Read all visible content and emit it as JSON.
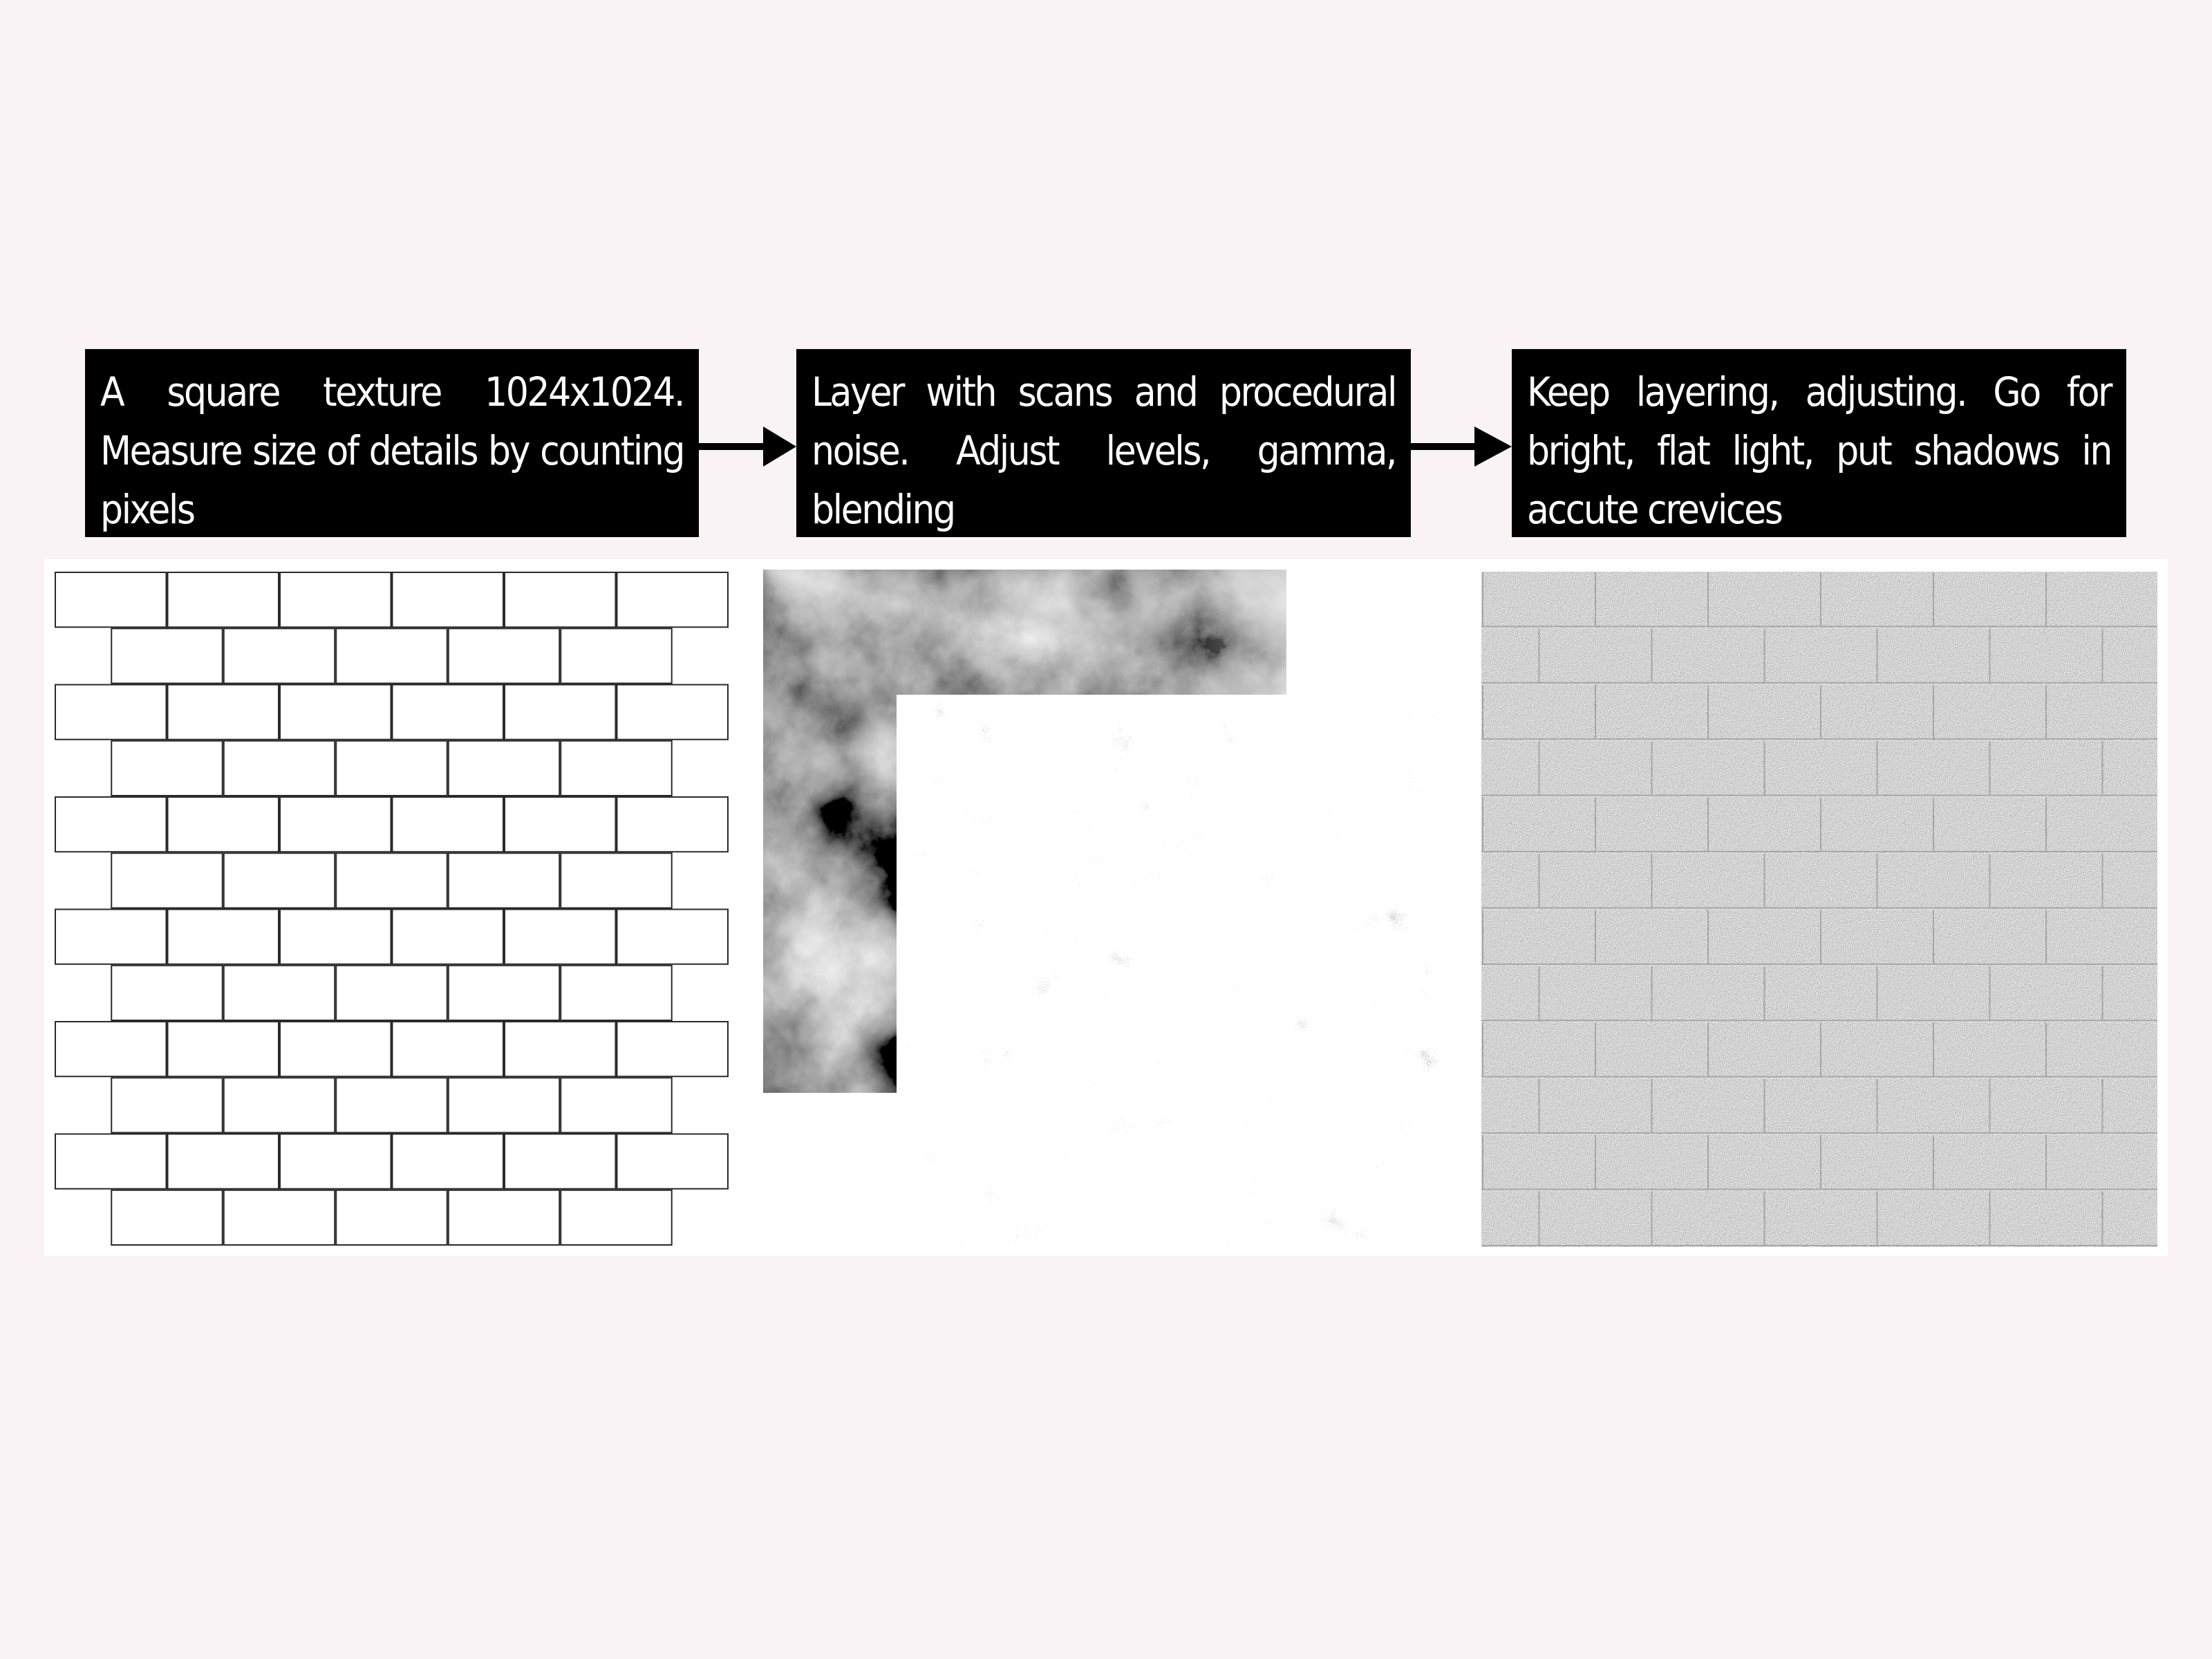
{
  "colors": {
    "page_background": "#f9f3f5",
    "box_background": "#000000",
    "box_text": "#ffffff",
    "panel_background": "#ffffff",
    "brick_line": "#2a2a2a",
    "final_brick_fill": "#ececec",
    "final_brick_groove": "#9a9a9a"
  },
  "steps": [
    {
      "id": "step-1",
      "text": "A square texture 1024x1024. Measure size of details by counting pixels"
    },
    {
      "id": "step-2",
      "text": "Layer with scans and procedural noise. Adjust levels, gamma, blending"
    },
    {
      "id": "step-3",
      "text": "Keep layering, adjusting. Go for bright, flat light, put shadows in accute crevices"
    }
  ],
  "arrows": [
    {
      "from": "step-1",
      "to": "step-2",
      "icon": "arrow-right-icon"
    },
    {
      "from": "step-2",
      "to": "step-3",
      "icon": "arrow-right-icon"
    }
  ],
  "textures": {
    "base_bricks": {
      "description": "line-drawing brick layout",
      "columns": 6,
      "rows": 12
    },
    "cloud_layer": {
      "description": "grayscale cloud noise"
    },
    "noise_layer": {
      "description": "grayscale grunge scan noise"
    },
    "final_bricks": {
      "description": "bright flat-lit brick texture with crevice shadows",
      "columns": 6,
      "rows": 12
    }
  }
}
